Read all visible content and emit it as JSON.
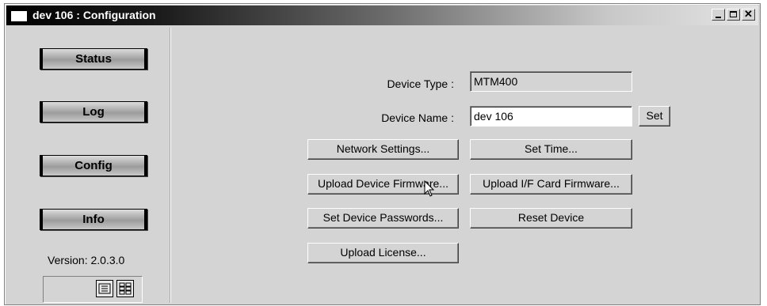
{
  "window": {
    "title": "dev 106 : Configuration"
  },
  "sidebar": {
    "nav": [
      {
        "label": "Status"
      },
      {
        "label": "Log"
      },
      {
        "label": "Config"
      },
      {
        "label": "Info"
      }
    ],
    "version": "Version: 2.0.3.0",
    "view_icons": [
      "list-view-icon",
      "grid-view-icon"
    ]
  },
  "config": {
    "device_type_label": "Device Type :",
    "device_type_value": "MTM400",
    "device_name_label": "Device Name :",
    "device_name_value": "dev 106",
    "set_label": "Set",
    "buttons": {
      "network_settings": "Network Settings...",
      "set_time": "Set Time...",
      "upload_device_firmware": "Upload Device Firmware...",
      "upload_if_card_firmware": "Upload I/F Card Firmware...",
      "set_device_passwords": "Set Device Passwords...",
      "reset_device": "Reset Device",
      "upload_license": "Upload License..."
    }
  }
}
